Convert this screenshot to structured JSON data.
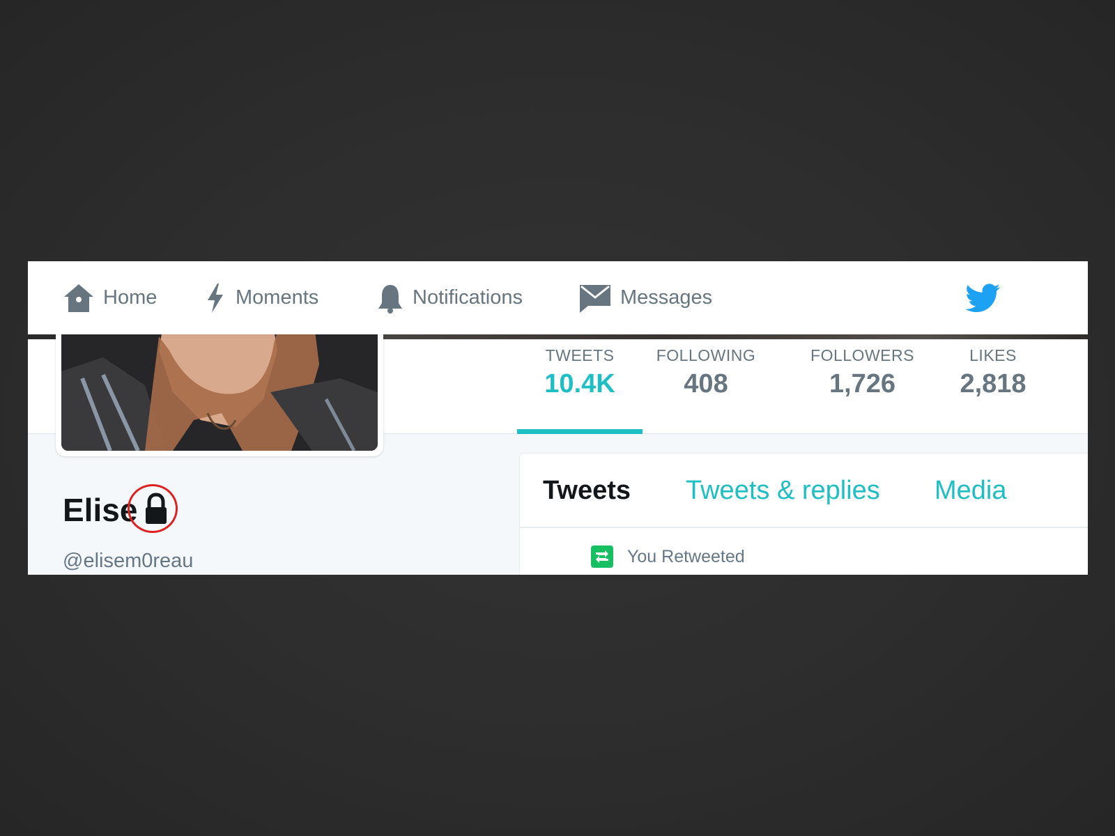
{
  "nav": {
    "home": "Home",
    "moments": "Moments",
    "notifications": "Notifications",
    "messages": "Messages",
    "logo_icon": "twitter-bird-icon"
  },
  "stats": {
    "tweets": {
      "label": "TWEETS",
      "value": "10.4K"
    },
    "following": {
      "label": "FOLLOWING",
      "value": "408"
    },
    "followers": {
      "label": "FOLLOWERS",
      "value": "1,726"
    },
    "likes": {
      "label": "LIKES",
      "value": "2,818"
    }
  },
  "profile": {
    "name": "Elise",
    "handle": "@elisem0reau",
    "protected_icon": "lock-icon"
  },
  "timeline": {
    "tabs": [
      "Tweets",
      "Tweets & replies",
      "Media"
    ],
    "retweet_label": "You Retweeted"
  },
  "colors": {
    "accent": "#1dbfc4",
    "nav_text": "#66757f",
    "twitter_blue": "#1da1f2",
    "highlight_circle": "#e02020",
    "retweet_green": "#17bf63"
  }
}
